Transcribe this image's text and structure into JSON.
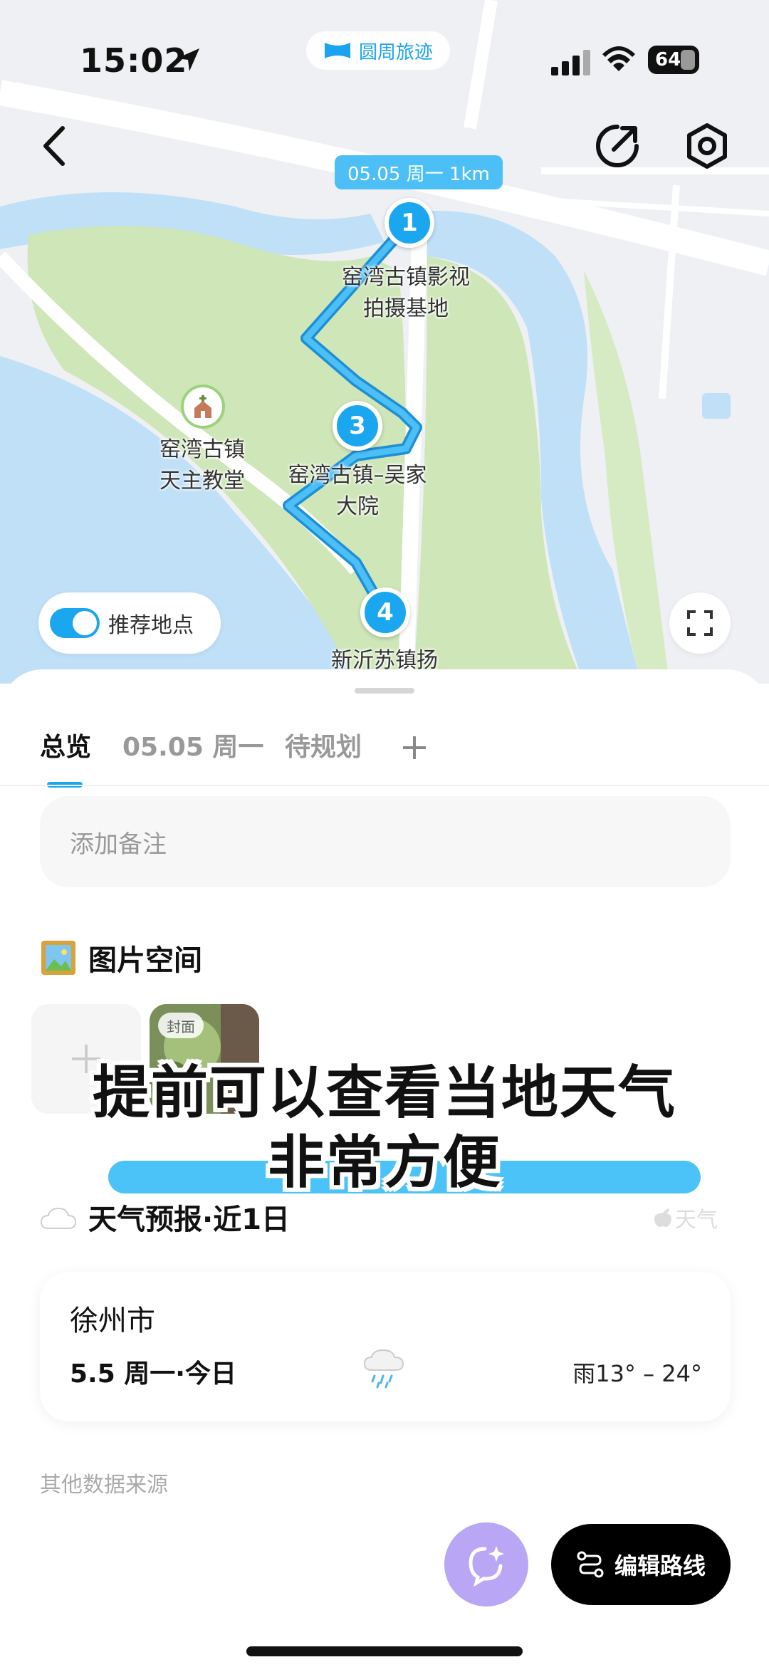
{
  "status_bar": {
    "time": "15:02",
    "battery": "64"
  },
  "app_badge": "圆周旅迹",
  "route_tag": "05.05 周一 1km",
  "markers": [
    {
      "number": "1",
      "label_line1": "窑湾古镇影视",
      "label_line2": "拍摄基地"
    },
    {
      "number": "3",
      "label_line1": "窑湾古镇–吴家",
      "label_line2": "大院"
    },
    {
      "number": "4",
      "label_line1": "新沂苏镇扬",
      "label_line2": ""
    }
  ],
  "poi": {
    "line1": "窑湾古镇",
    "line2": "天主教堂"
  },
  "recommend_toggle": {
    "label": "推荐地点",
    "on": true
  },
  "tabs": [
    {
      "label": "总览",
      "active": true
    },
    {
      "label": "05.05 周一",
      "active": false
    },
    {
      "label": "待规划",
      "active": false
    }
  ],
  "note_placeholder": "添加备注",
  "photo_section": {
    "title": "图片空间",
    "cover_label": "封面"
  },
  "overlay_caption": {
    "line1": "提前可以查看当地天气",
    "line2": "非常方便"
  },
  "weather": {
    "title": "天气预报·近1日",
    "source": "天气",
    "city": "徐州市",
    "day": "5.5 周一·今日",
    "condition": "雨",
    "temp_range": "雨13° – 24°"
  },
  "other_source": "其他数据来源",
  "edit_route_label": "编辑路线",
  "colors": {
    "accent": "#1ba7ef",
    "ai_button": "#b9a6f5",
    "route": "#4cbff7"
  }
}
